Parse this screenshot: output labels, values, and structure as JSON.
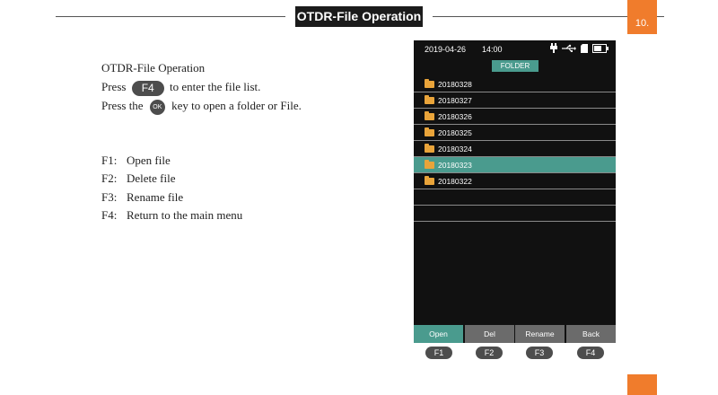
{
  "header": {
    "title": "OTDR-File Operation",
    "page_number": "10."
  },
  "instructions": {
    "heading": "OTDR-File Operation",
    "line1_pre": "Press",
    "line1_key": "F4",
    "line1_post": "to enter the file list.",
    "line2_pre": "Press the",
    "line2_key": "OK",
    "line2_post": "key to open a folder or File."
  },
  "functions": [
    {
      "key": "F1:",
      "label": "Open file"
    },
    {
      "key": "F2:",
      "label": "Delete file"
    },
    {
      "key": "F3:",
      "label": "Rename file"
    },
    {
      "key": "F4:",
      "label": "Return to the main menu"
    }
  ],
  "device": {
    "status": {
      "date": "2019-04-26",
      "time": "14:00",
      "icons": [
        "plug-icon",
        "usb-icon",
        "sd-card-icon",
        "battery-icon"
      ]
    },
    "folder_label": "FOLDER",
    "files": [
      "20180328",
      "20180327",
      "20180326",
      "20180325",
      "20180324",
      "20180323",
      "20180322"
    ],
    "selected_index": 5,
    "softkeys": [
      "Open",
      "Del",
      "Rename",
      "Back"
    ],
    "fkeys": [
      "F1",
      "F2",
      "F3",
      "F4"
    ]
  },
  "colors": {
    "accent": "#f07c2c",
    "teal": "#4a9b8e",
    "dark": "#1b1b1b"
  }
}
